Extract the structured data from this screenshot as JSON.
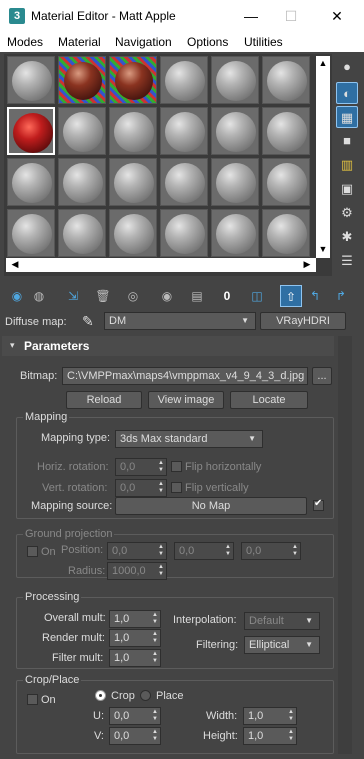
{
  "window": {
    "title": "Material Editor - Matt Apple",
    "app_icon": "3",
    "minimize": "—",
    "maximize": "☐",
    "close": "✕"
  },
  "menu": [
    "Modes",
    "Material",
    "Navigation",
    "Options",
    "Utilities"
  ],
  "slots": {
    "rows": [
      [
        "gray",
        "brick",
        "brick",
        "gray",
        "gray",
        "gray"
      ],
      [
        "red",
        "gray",
        "gray",
        "gray",
        "gray",
        "gray"
      ],
      [
        "gray",
        "gray",
        "gray",
        "gray",
        "gray",
        "gray"
      ],
      [
        "gray",
        "gray",
        "gray",
        "gray",
        "gray",
        "gray"
      ]
    ],
    "selected": "red"
  },
  "side_tools": [
    "sample-type-icon",
    "backlight-icon",
    "background-icon",
    "sample-uv-tiling-icon",
    "video-color-check-icon",
    "make-preview-icon",
    "options-icon",
    "select-by-material-icon",
    "material-map-navigator-icon"
  ],
  "toolbar_icons": [
    "get-material-icon",
    "put-to-scene-icon",
    "assign-to-selection-icon",
    "reset-map-icon",
    "make-unique-icon",
    "put-to-library-icon",
    "material-id-icon",
    "show-shaded-material-icon",
    "show-end-result-icon",
    "go-to-parent-icon",
    "go-forward-sibling-icon"
  ],
  "material_id": "0",
  "diffuse": {
    "label": "Diffuse map:",
    "name": "DM",
    "type_button": "VRayHDRI"
  },
  "parameters": {
    "title": "Parameters",
    "collapse_glyph": "▾",
    "bitmap_label": "Bitmap:",
    "bitmap_path": "C:\\VMPPmax\\maps4\\vmppmax_v4_9_4_3_d.jpg",
    "browse": "...",
    "reload": "Reload",
    "view_image": "View image",
    "locate": "Locate"
  },
  "mapping": {
    "title": "Mapping",
    "type_label": "Mapping type:",
    "type_value": "3ds Max standard",
    "horiz_label": "Horiz. rotation:",
    "horiz_value": "0,0",
    "flip_h": "Flip horizontally",
    "vert_label": "Vert. rotation:",
    "vert_value": "0,0",
    "flip_v": "Flip vertically",
    "source_label": "Mapping source:",
    "source_value": "No Map",
    "source_checked": true
  },
  "ground": {
    "title": "Ground projection",
    "on_label": "On",
    "position_label": "Position:",
    "pos_x": "0,0",
    "pos_y": "0,0",
    "pos_z": "0,0",
    "radius_label": "Radius:",
    "radius": "1000,0"
  },
  "processing": {
    "title": "Processing",
    "overall_label": "Overall mult:",
    "overall": "1,0",
    "render_label": "Render mult:",
    "render": "1,0",
    "filter_label": "Filter mult:",
    "filter": "1,0",
    "interp_label": "Interpolation:",
    "interp": "Default",
    "filtering_label": "Filtering:",
    "filtering": "Elliptical"
  },
  "crop": {
    "title": "Crop/Place",
    "on_label": "On",
    "crop_label": "Crop",
    "place_label": "Place",
    "u_label": "U:",
    "u": "0,0",
    "v_label": "V:",
    "v": "0,0",
    "width_label": "Width:",
    "width": "1,0",
    "height_label": "Height:",
    "height": "1,0"
  }
}
